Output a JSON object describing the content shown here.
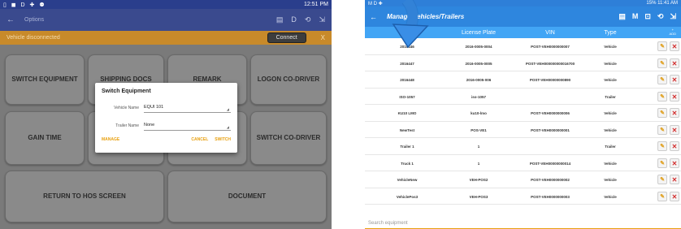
{
  "left": {
    "status_bar": {
      "left_icons": "▯ ◼ D ✚ ⚉",
      "right": "12:51 PM"
    },
    "app_bar": {
      "back": "←",
      "title": "Options",
      "actions": [
        "▤",
        "D",
        "⟲",
        "⇲"
      ]
    },
    "warning": {
      "message": "Vehicle disconnected",
      "connect_label": "Connect",
      "close": "X"
    },
    "buttons": [
      "SWITCH EQUIPMENT",
      "SHIPPING DOCS",
      "REMARK",
      "LOGON CO-DRIVER",
      "GAIN TIME",
      "SWITCH CO-DRIVER",
      "RETURN TO HOS SCREEN",
      "DOCUMENT"
    ],
    "dialog": {
      "title": "Switch Equipment",
      "vehicle_label": "Vehicle Name",
      "vehicle_value": "EQUI 101",
      "trailer_label": "Trailer Name",
      "trailer_value": "None",
      "manage": "MANAGE",
      "cancel": "CANCEL",
      "switch": "SWITCH"
    }
  },
  "right": {
    "status_bar": {
      "left_icons": "M D ✚",
      "right": "15% 11:41 AM"
    },
    "app_bar": {
      "back": "←",
      "title": "Manage Vehicles/Trailers",
      "actions": [
        "▤",
        "M",
        "⊡",
        "⟲",
        "⇲"
      ]
    },
    "columns": [
      "Name",
      "License Plate",
      "VIN",
      "Type"
    ],
    "add_label": "ADD",
    "rows": [
      {
        "name": "2016446",
        "plate": "2016-0005-0004",
        "vin": "POST-VEH0000000007",
        "type": "Vehicle"
      },
      {
        "name": "2016447",
        "plate": "2016-0005-0005",
        "vin": "POST-VEH000000000016700",
        "type": "Vehicle"
      },
      {
        "name": "2016448",
        "plate": "2016-0005-006",
        "vin": "POST-VEH00000000890",
        "type": "Vehicle"
      },
      {
        "name": "ISO-1057",
        "plate": "iso-1057",
        "vin": "",
        "type": "Trailer"
      },
      {
        "name": "KU10 LMO",
        "plate": "ku10-lmo",
        "vin": "POST-VEH0000000006",
        "type": "Vehicle"
      },
      {
        "name": "NewTest",
        "plate": "POS-VE1",
        "vin": "POST-VEH0000000001",
        "type": "Vehicle"
      },
      {
        "name": "Trailer 1",
        "plate": "1",
        "vin": "",
        "type": "Trailer"
      },
      {
        "name": "Truck 1",
        "plate": "1",
        "vin": "POST-VEH00000000014",
        "type": "Vehicle"
      },
      {
        "name": "VehicleNew",
        "plate": "VEH-POS2",
        "vin": "POST-VEH0000000002",
        "type": "Vehicle"
      },
      {
        "name": "VehiclePos3",
        "plate": "VEH-POS3",
        "vin": "POST-VEH0000000003",
        "type": "Vehicle"
      }
    ],
    "edit_icon": "✎",
    "delete_icon": "✕",
    "search_placeholder": "Search equipment"
  },
  "colors": {
    "left_appbar": "#3a4a8e",
    "warning": "#c88a2a",
    "right_appbar": "#2e86de",
    "table_header": "#42a5f5",
    "accent": "#e8a010"
  }
}
